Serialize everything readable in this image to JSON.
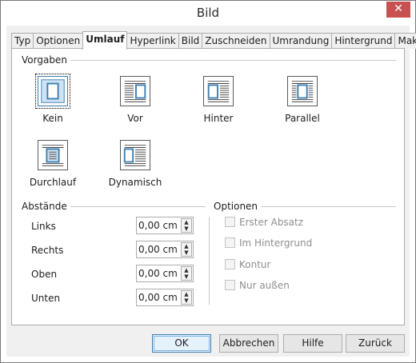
{
  "window": {
    "title": "Bild",
    "close_glyph": "✕"
  },
  "tabs": [
    {
      "label": "Typ"
    },
    {
      "label": "Optionen"
    },
    {
      "label": "Umlauf",
      "active": true
    },
    {
      "label": "Hyperlink"
    },
    {
      "label": "Bild"
    },
    {
      "label": "Zuschneiden"
    },
    {
      "label": "Umrandung"
    },
    {
      "label": "Hintergrund"
    },
    {
      "label": "Makro"
    }
  ],
  "vorgaben": {
    "label": "Vorgaben",
    "options": [
      {
        "label": "Kein",
        "icon": "wrap-none-icon",
        "selected": true
      },
      {
        "label": "Vor",
        "icon": "wrap-before-icon"
      },
      {
        "label": "Hinter",
        "icon": "wrap-after-icon"
      },
      {
        "label": "Parallel",
        "icon": "wrap-parallel-icon"
      },
      {
        "label": "Durchlauf",
        "icon": "wrap-through-icon"
      },
      {
        "label": "Dynamisch",
        "icon": "wrap-optimal-icon"
      }
    ]
  },
  "abstaende": {
    "label": "Abstände",
    "rows": [
      {
        "label": "Links",
        "value": "0,00 cm"
      },
      {
        "label": "Rechts",
        "value": "0,00 cm"
      },
      {
        "label": "Oben",
        "value": "0,00 cm"
      },
      {
        "label": "Unten",
        "value": "0,00 cm"
      }
    ]
  },
  "optionen": {
    "label": "Optionen",
    "checkboxes": [
      {
        "label": "Erster Absatz",
        "checked": false,
        "disabled": true
      },
      {
        "label": "Im Hintergrund",
        "checked": false,
        "disabled": true
      },
      {
        "label": "Kontur",
        "checked": false,
        "disabled": true
      },
      {
        "label": "Nur außen",
        "checked": false,
        "disabled": true
      }
    ]
  },
  "buttons": {
    "ok": "OK",
    "cancel": "Abbrechen",
    "help": "Hilfe",
    "reset": "Zurück"
  },
  "colors": {
    "accent": "#3c7fb1",
    "close": "#c75050",
    "dialog_bg": "#f0f0f0"
  }
}
